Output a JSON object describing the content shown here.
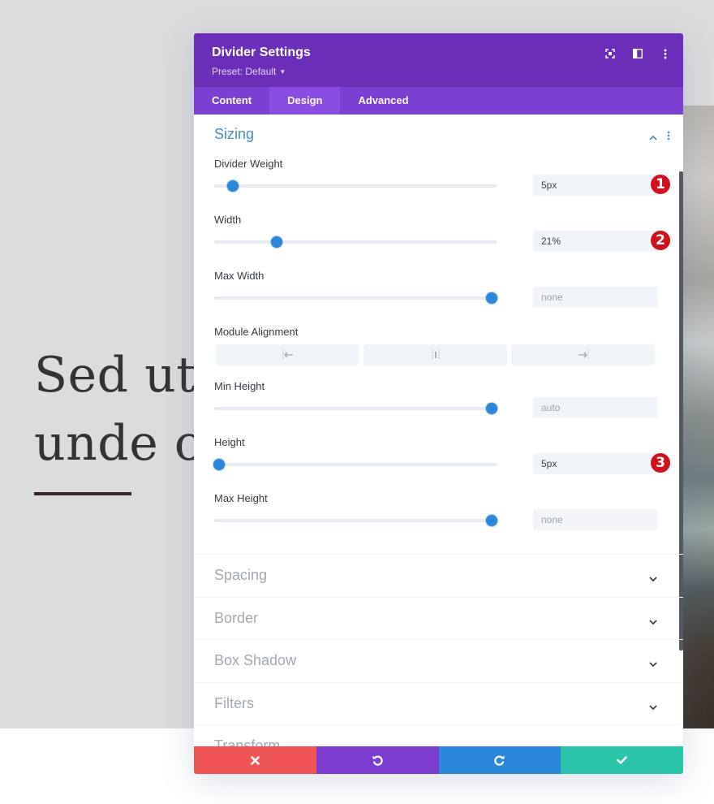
{
  "page": {
    "hero_lines": [
      "Sed ut p",
      "unde or"
    ]
  },
  "modal": {
    "title": "Divider Settings",
    "preset_label": "Preset: Default",
    "header_icons": [
      "expand-icon",
      "sidebar-toggle-icon",
      "more-options-icon"
    ],
    "tabs": [
      {
        "label": "Content",
        "active": false
      },
      {
        "label": "Design",
        "active": true
      },
      {
        "label": "Advanced",
        "active": false
      }
    ],
    "open_section": {
      "title": "Sizing",
      "fields": [
        {
          "label": "Divider Weight",
          "value": "5px",
          "is_placeholder": false,
          "slider_percent": 6.6,
          "badge": "1"
        },
        {
          "label": "Width",
          "value": "21%",
          "is_placeholder": false,
          "slider_percent": 22,
          "badge": "2"
        },
        {
          "label": "Max Width",
          "value": "none",
          "is_placeholder": true,
          "slider_percent": 98,
          "badge": null
        },
        {
          "label": "Module Alignment",
          "type": "alignment",
          "options": [
            "left",
            "center",
            "right"
          ]
        },
        {
          "label": "Min Height",
          "value": "auto",
          "is_placeholder": true,
          "slider_percent": 98,
          "badge": null
        },
        {
          "label": "Height",
          "value": "5px",
          "is_placeholder": false,
          "slider_percent": 1.7,
          "badge": "3"
        },
        {
          "label": "Max Height",
          "value": "none",
          "is_placeholder": true,
          "slider_percent": 98,
          "badge": null
        }
      ]
    },
    "collapsed_sections": [
      "Spacing",
      "Border",
      "Box Shadow",
      "Filters",
      "Transform"
    ],
    "footer": {
      "discard_icon": "close-icon",
      "undo_icon": "undo-icon",
      "redo_icon": "redo-icon",
      "save_icon": "check-icon"
    }
  },
  "colors": {
    "header": "#6c2eb9",
    "tabs": "#7b3fd3",
    "active_tab": "#8b4ce3",
    "accent_blue": "#2b87da",
    "section_title": "#4d8dc1",
    "badge": "#d0101b",
    "discard": "#ef5555",
    "undo": "#7e3bd0",
    "redo": "#2b87da",
    "save": "#29c4a9"
  }
}
